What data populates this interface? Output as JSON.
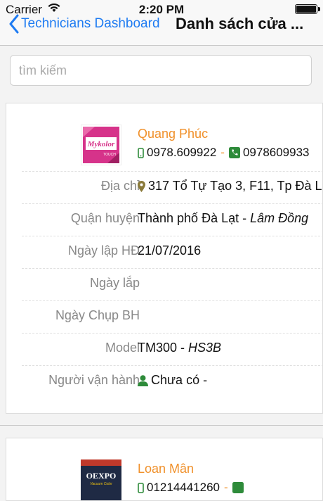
{
  "status_bar": {
    "carrier": "Carrier",
    "time": "2:20 PM",
    "battery_level": 1.0
  },
  "nav": {
    "back_label": "Technicians Dashboard",
    "title": "Danh sách cửa ..."
  },
  "search": {
    "placeholder": "tìm kiếm",
    "value": ""
  },
  "stores": [
    {
      "logo_text": "Mykolor",
      "logo_sub": "TOUCH",
      "name": "Quang Phúc",
      "phone_mobile": "0978.609922",
      "phone_separator": "-",
      "phone_landline": "0978609933",
      "details": [
        {
          "label": "Địa chỉ",
          "value": "317 Tổ Tự Tạo 3, F11, Tp Đà L",
          "icon": "map-marker-icon"
        },
        {
          "label": "Quận huyện",
          "value": "Thành phố Đà Lạt - ",
          "value_em": "Lâm Đồng"
        },
        {
          "label": "Ngày lập HĐ",
          "value": "21/07/2016"
        },
        {
          "label": "Ngày lắp",
          "value": ""
        },
        {
          "label": "Ngày Chụp BH",
          "value": ""
        },
        {
          "label": "Model",
          "value": "TM300 - ",
          "value_em": "HS3B"
        },
        {
          "label": "Người vận hành",
          "value": "Chưa có -",
          "icon": "user-icon"
        }
      ]
    },
    {
      "logo_text": "OEXPO",
      "logo_sub": "Vacuum Color",
      "name": "Loan Mân",
      "phone_mobile": "01214441260",
      "phone_separator": "-",
      "phone_landline": ""
    }
  ],
  "colors": {
    "accent": "#1e7bf2",
    "store_name": "#f0902a",
    "phone_icon_mobile": "#2e8b3a",
    "phone_icon_landline": "#2e8b3a",
    "marker": "#8a7a3a",
    "user": "#2e8b3a"
  }
}
